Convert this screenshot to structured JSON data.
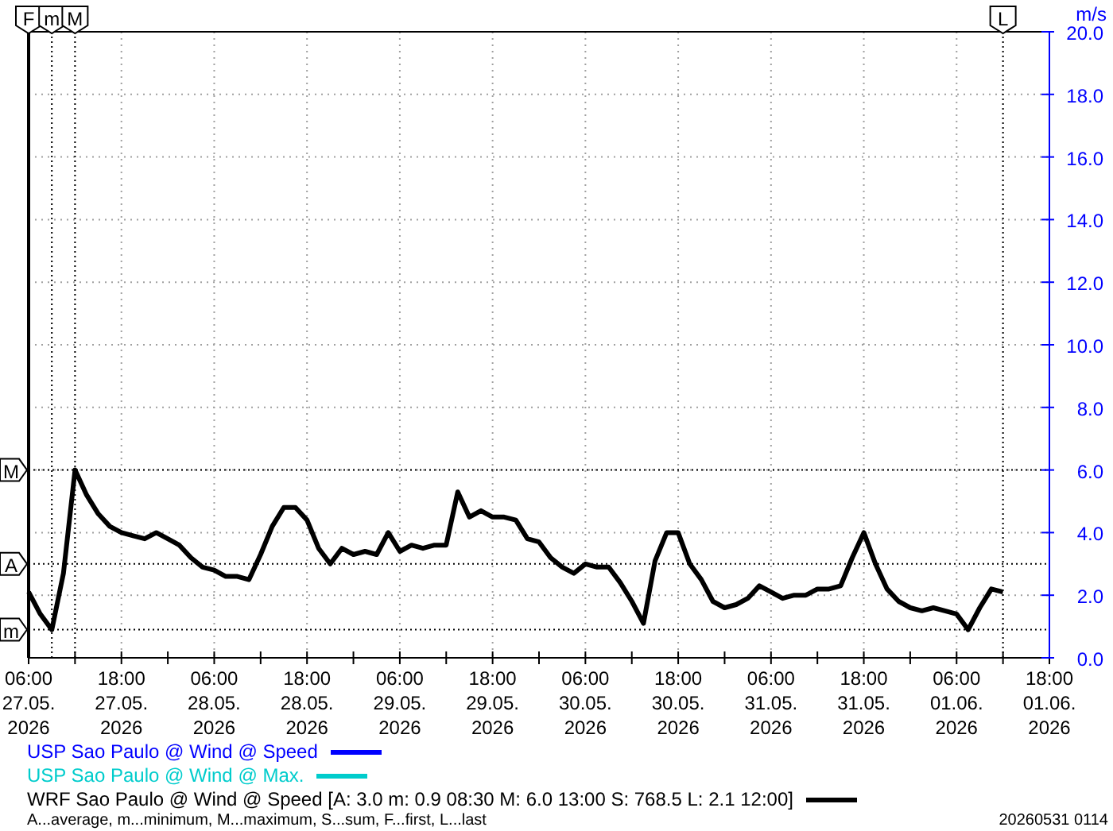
{
  "chart": {
    "chart_data": {
      "type": "line",
      "ylabel": "m/s",
      "grid": true,
      "ylim": [
        0,
        20
      ],
      "yticks": [
        {
          "value": 0,
          "label": "0.0"
        },
        {
          "value": 2,
          "label": "2.0"
        },
        {
          "value": 4,
          "label": "4.0"
        },
        {
          "value": 6,
          "label": "6.0"
        },
        {
          "value": 8,
          "label": "8.0"
        },
        {
          "value": 10,
          "label": "10.0"
        },
        {
          "value": 12,
          "label": "12.0"
        },
        {
          "value": 14,
          "label": "14.0"
        },
        {
          "value": 16,
          "label": "16.0"
        },
        {
          "value": 18,
          "label": "18.0"
        },
        {
          "value": 20,
          "label": "20.0"
        }
      ],
      "categories": [
        "06:00\n27.05.\n2026",
        null,
        null,
        null,
        null,
        null,
        null,
        null,
        "18:00\n27.05.\n2026",
        null,
        null,
        null,
        null,
        null,
        null,
        null,
        "06:00\n28.05.\n2026",
        null,
        null,
        null,
        null,
        null,
        null,
        null,
        "18:00\n28.05.\n2026",
        null,
        null,
        null,
        null,
        null,
        null,
        null,
        "06:00\n29.05.\n2026",
        null,
        null,
        null,
        null,
        null,
        null,
        null,
        "18:00\n29.05.\n2026",
        null,
        null,
        null,
        null,
        null,
        null,
        null,
        "06:00\n30.05.\n2026",
        null,
        null,
        null,
        null,
        null,
        null,
        null,
        "18:00\n30.05.\n2026",
        null,
        null,
        null,
        null,
        null,
        null,
        null,
        "06:00\n31.05.\n2026",
        null,
        null,
        null,
        null,
        null,
        null,
        null,
        "18:00\n31.05.\n2026",
        null,
        null,
        null,
        null,
        null,
        null,
        null,
        "06:00\n01.06.\n2026",
        null,
        null,
        null,
        null,
        null,
        null,
        null,
        "18:00\n01.06.\n2026"
      ],
      "series": [
        {
          "name": "WRF Sao Paulo @ Wind @ Speed",
          "color": "#000000",
          "values": [
            2.1,
            1.4,
            0.9,
            2.7,
            6.0,
            5.2,
            4.6,
            4.2,
            4.0,
            3.9,
            3.8,
            4.0,
            3.8,
            3.6,
            3.2,
            2.9,
            2.8,
            2.6,
            2.6,
            2.5,
            3.3,
            4.2,
            4.8,
            4.8,
            4.4,
            3.5,
            3.0,
            3.5,
            3.3,
            3.4,
            3.3,
            4.0,
            3.4,
            3.6,
            3.5,
            3.6,
            3.6,
            5.3,
            4.5,
            4.7,
            4.5,
            4.5,
            4.4,
            3.8,
            3.7,
            3.2,
            2.9,
            2.7,
            3.0,
            2.9,
            2.9,
            2.4,
            1.8,
            1.1,
            3.1,
            4.0,
            4.0,
            3.0,
            2.5,
            1.8,
            1.6,
            1.7,
            1.9,
            2.3,
            2.1,
            1.9,
            2.0,
            2.0,
            2.2,
            2.2,
            2.3,
            3.2,
            4.0,
            3.0,
            2.2,
            1.8,
            1.6,
            1.5,
            1.6,
            1.5,
            1.4,
            0.9,
            1.6,
            2.2,
            2.1,
            null,
            null,
            null,
            null
          ]
        }
      ],
      "annotations": [
        {
          "text": "M",
          "y": 6.0
        },
        {
          "text": "A",
          "y": 3.0
        },
        {
          "text": "m",
          "y": 0.9
        }
      ]
    },
    "time_markers": [
      {
        "text": "F",
        "kind": "first"
      },
      {
        "text": "m",
        "kind": "min"
      },
      {
        "text": "M",
        "kind": "max"
      },
      {
        "text": "L",
        "kind": "last"
      }
    ]
  },
  "legend": [
    {
      "kind": "plain",
      "text": "USP Sao Paulo @ Wind @ Speed",
      "color": "#0000ff"
    },
    {
      "kind": "plain",
      "text": "USP Sao Paulo @ Wind @ Max.",
      "color": "#00cccc"
    },
    {
      "kind": "series",
      "stats": "[A: 3.0 m: 0.9 08:30 M: 6.0 13:00 S: 768.5 L: 2.1 12:00]"
    }
  ],
  "footnote": "A...average, m...minimum, M...maximum, S...sum, F...first, L...last",
  "timestamp": "20260531 0114"
}
